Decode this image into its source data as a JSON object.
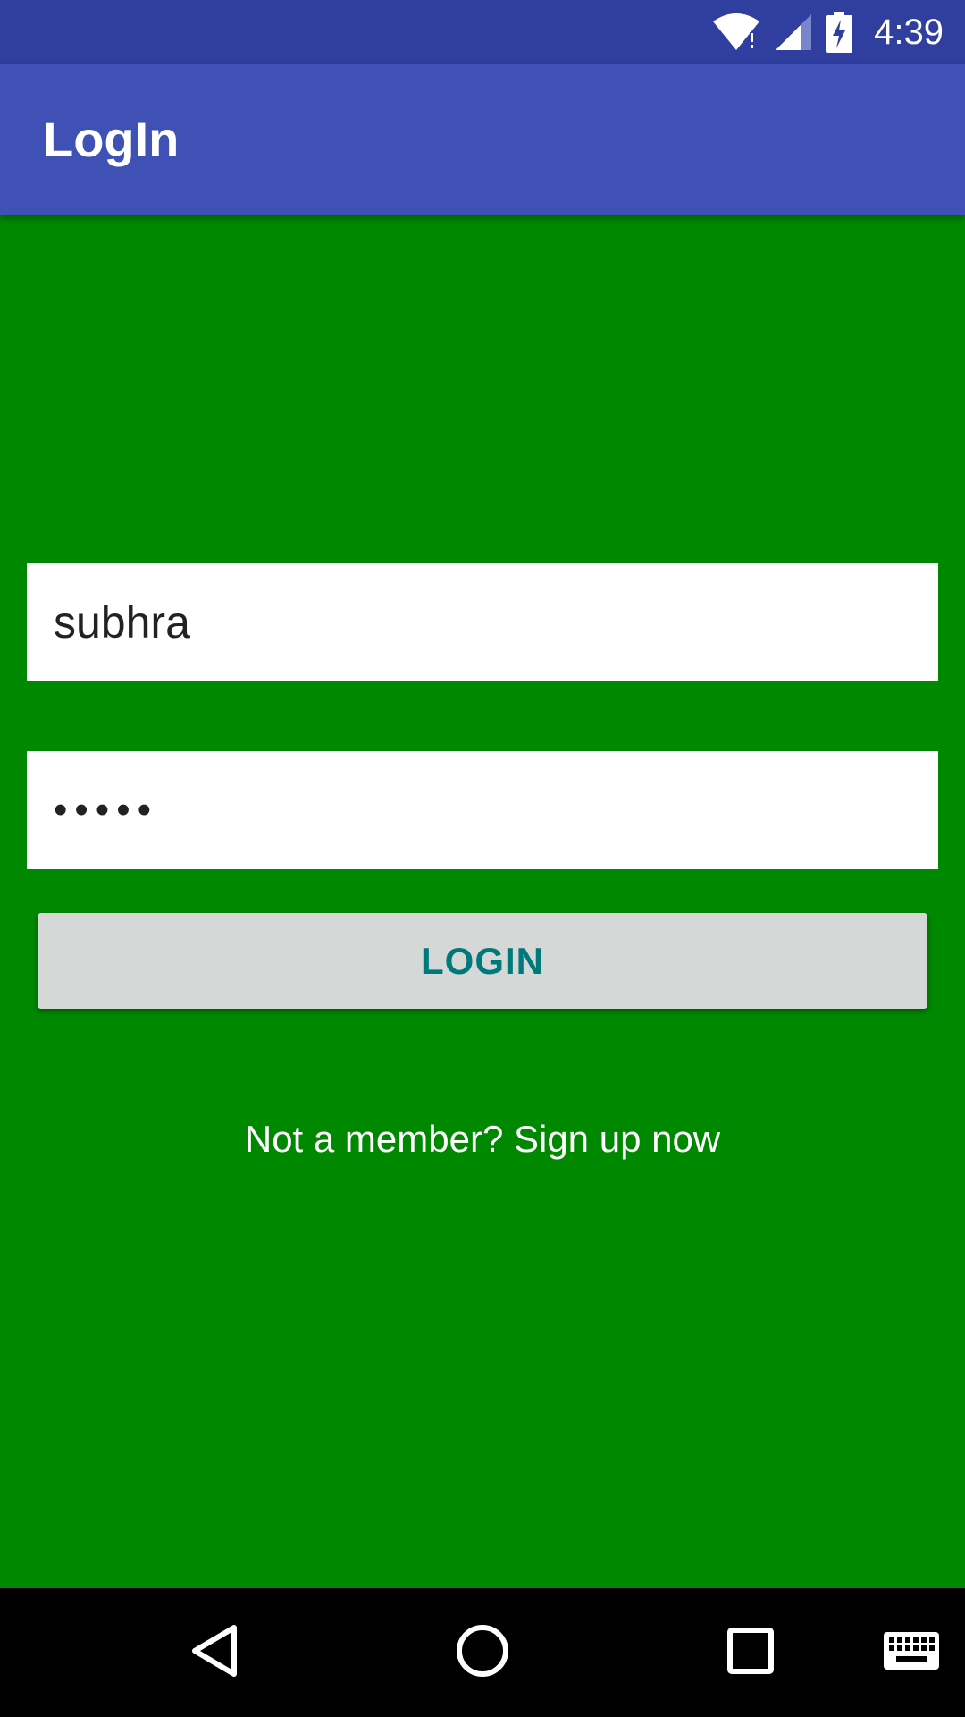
{
  "status_bar": {
    "time": "4:39",
    "icons": [
      "wifi-icon",
      "cell-signal-icon",
      "battery-charging-icon"
    ],
    "color": "#303F9F"
  },
  "app_bar": {
    "title": "LogIn",
    "color": "#3F51B5"
  },
  "form": {
    "username_value": "subhra",
    "password_value": "•••••",
    "login_label": "LOGIN",
    "signup_text": "Not a member? Sign up now"
  },
  "colors": {
    "background": "#008800",
    "button_bg": "#D6D7D7",
    "button_text": "#00797A"
  },
  "nav_bar": {
    "icons": [
      "back-icon",
      "home-icon",
      "recents-icon",
      "keyboard-icon"
    ]
  }
}
